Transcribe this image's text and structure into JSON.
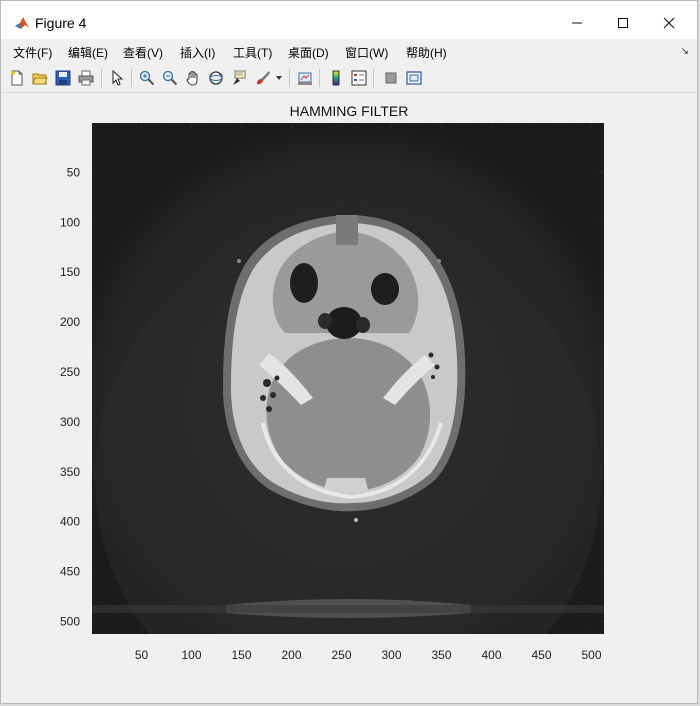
{
  "window": {
    "title": "Figure 4",
    "controls": {
      "minimize": "—",
      "maximize": "☐",
      "close": "✕"
    }
  },
  "menu": {
    "items": [
      "文件(F)",
      "编辑(E)",
      "查看(V)",
      "插入(I)",
      "工具(T)",
      "桌面(D)",
      "窗口(W)",
      "帮助(H)"
    ]
  },
  "toolbar": {
    "icons": [
      "new-figure-icon",
      "open-file-icon",
      "save-icon",
      "print-icon",
      "pointer-icon",
      "zoom-in-icon",
      "zoom-out-icon",
      "pan-hand-icon",
      "rotate-3d-icon",
      "data-cursor-icon",
      "brush-icon",
      "brush-dropdown-icon",
      "link-plot-icon",
      "colorbar-icon",
      "legend-icon",
      "hide-plot-tools-icon",
      "show-plot-tools-icon"
    ]
  },
  "plot": {
    "title": "HAMMING FILTER",
    "x_ticks": [
      "50",
      "100",
      "150",
      "200",
      "250",
      "300",
      "350",
      "400",
      "450",
      "500"
    ],
    "y_ticks": [
      "50",
      "100",
      "150",
      "200",
      "250",
      "300",
      "350",
      "400",
      "450",
      "500"
    ],
    "x_tick_values": [
      50,
      100,
      150,
      200,
      250,
      300,
      350,
      400,
      450,
      500
    ],
    "y_tick_values": [
      50,
      100,
      150,
      200,
      250,
      300,
      350,
      400,
      450,
      500
    ],
    "x_range": [
      0.5,
      512.5
    ],
    "y_range": [
      0.5,
      512.5
    ],
    "image": "CT head slice reconstructed with Hamming filter (grayscale)"
  },
  "colors": {
    "background": "#1e1e1e",
    "bone": "#d8d8d8",
    "tissue": "#8a8a8a"
  }
}
